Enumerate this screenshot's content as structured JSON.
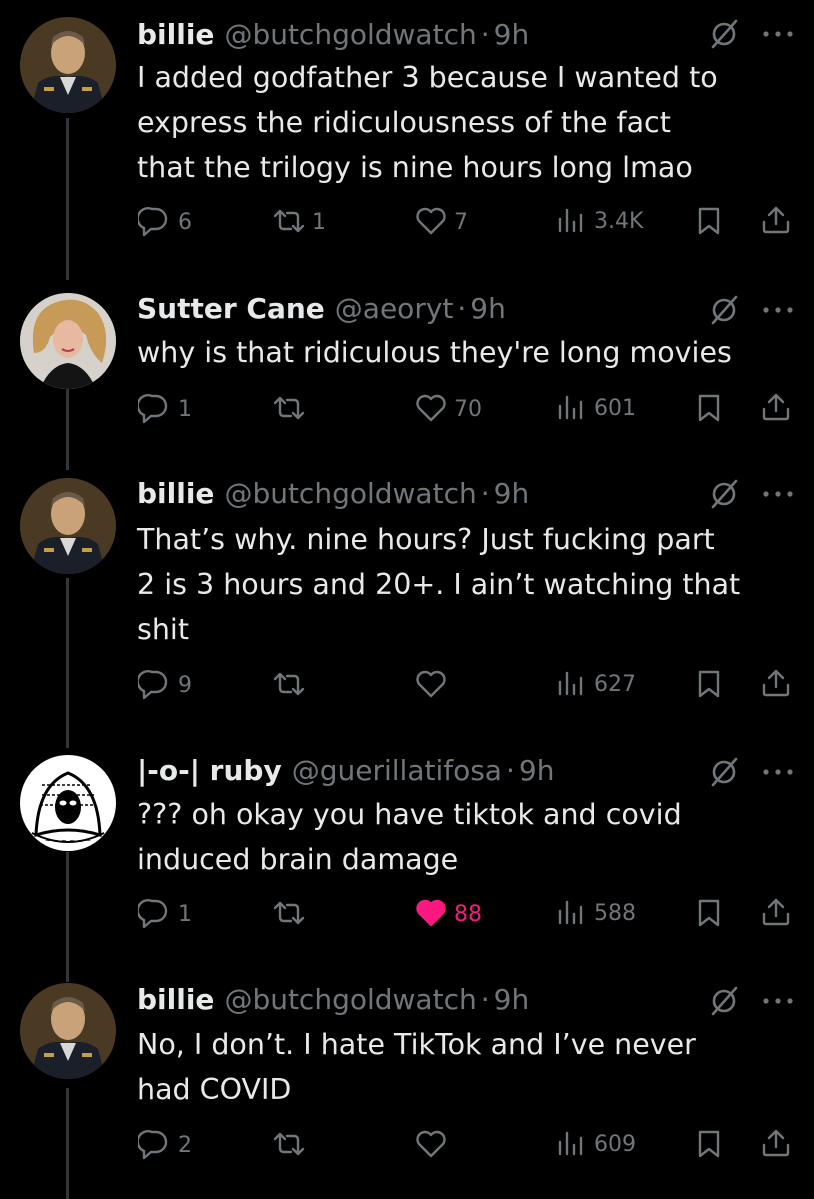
{
  "colors": {
    "background": "#000000",
    "text": "#e7e9ea",
    "muted": "#71767b",
    "like_active": "#f91880",
    "thread_line": "#333639"
  },
  "tweets": [
    {
      "display_name": "billie",
      "handle": "@butchgoldwatch",
      "dot": "·",
      "time": "9h",
      "text": "I added godfather 3 because I wanted to\nexpress the ridiculousness of the fact\nthat the trilogy is nine hours long lmao",
      "replies": "6",
      "reposts": "1",
      "likes": "7",
      "views": "3.4K",
      "liked": false,
      "avatar_icon": "avatar-photo-man-uniform"
    },
    {
      "display_name": "Sutter Cane",
      "handle": "@aeoryt",
      "dot": "·",
      "time": "9h",
      "text": "why is that ridiculous they're long movies",
      "replies": "1",
      "reposts": "",
      "likes": "70",
      "views": "601",
      "liked": false,
      "avatar_icon": "avatar-photo-woman-curly-hair"
    },
    {
      "display_name": "billie",
      "handle": "@butchgoldwatch",
      "dot": "·",
      "time": "9h",
      "text": "That’s why. nine hours? Just fucking part\n2 is 3 hours and 20+. I ain’t watching that\nshit",
      "replies": "9",
      "reposts": "",
      "likes": "",
      "views": "627",
      "liked": false,
      "avatar_icon": "avatar-photo-man-uniform"
    },
    {
      "display_name": "|-o-| ruby",
      "handle": "@guerillatifosa",
      "dot": "·",
      "time": "9h",
      "text": "??? oh okay you have tiktok and covid\ninduced brain damage",
      "replies": "1",
      "reposts": "",
      "likes": "88",
      "views": "588",
      "liked": true,
      "avatar_icon": "avatar-keffiyeh-drawing"
    },
    {
      "display_name": "billie",
      "handle": "@butchgoldwatch",
      "dot": "·",
      "time": "9h",
      "text": "No, I don’t. I hate TikTok and I’ve never\nhad COVID",
      "replies": "2",
      "reposts": "",
      "likes": "",
      "views": "609",
      "liked": false,
      "avatar_icon": "avatar-photo-man-uniform"
    }
  ]
}
